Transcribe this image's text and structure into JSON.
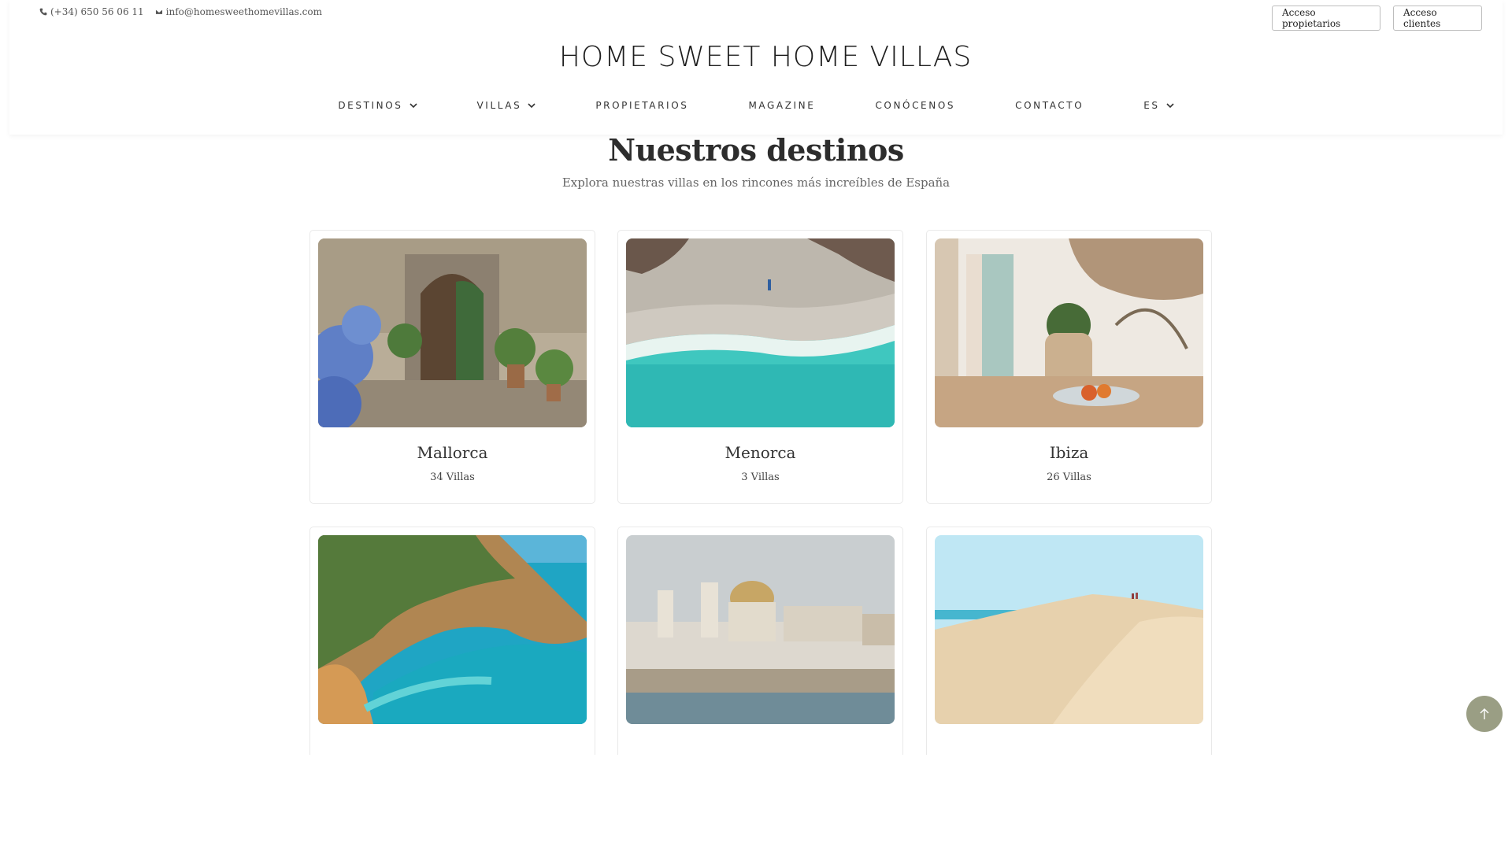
{
  "contact": {
    "phone": "(+34) 650 56 06 11",
    "email": "info@homesweethomevillas.com",
    "phone_icon": "phone-icon",
    "email_icon": "envelope-icon"
  },
  "access": {
    "owners_label": "Acceso propietarios",
    "clients_label": "Acceso clientes"
  },
  "logo": {
    "text": "HOME SWEET HOME VILLAS"
  },
  "nav": {
    "items": [
      {
        "label": "DESTINOS",
        "dropdown": true
      },
      {
        "label": "VILLAS",
        "dropdown": true
      },
      {
        "label": "PROPIETARIOS",
        "dropdown": false
      },
      {
        "label": "MAGAZINE",
        "dropdown": false
      },
      {
        "label": "CONÓCENOS",
        "dropdown": false
      },
      {
        "label": "CONTACTO",
        "dropdown": false
      },
      {
        "label": "ES",
        "dropdown": true
      }
    ]
  },
  "heading": {
    "title": "Nuestros destinos",
    "subtitle": "Explora nuestras villas en los rincones más increíbles de España"
  },
  "destinations": [
    {
      "name": "Mallorca",
      "count": "34 Villas"
    },
    {
      "name": "Menorca",
      "count": "3 Villas"
    },
    {
      "name": "Ibiza",
      "count": "26 Villas"
    },
    {
      "name": "",
      "count": ""
    },
    {
      "name": "",
      "count": ""
    },
    {
      "name": "",
      "count": ""
    }
  ],
  "scroll_top_icon": "arrow-up-icon",
  "colors": {
    "accent": "#9a9e84",
    "border": "#e9e9e9"
  }
}
